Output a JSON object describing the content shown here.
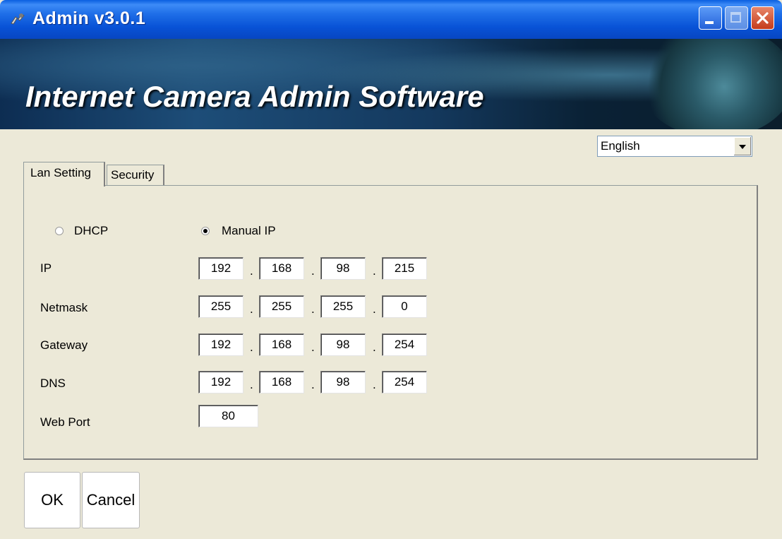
{
  "window": {
    "title": "Admin v3.0.1"
  },
  "banner": {
    "title": "Internet Camera Admin Software"
  },
  "language": {
    "selected": "English"
  },
  "tabs": [
    {
      "label": "Lan Setting",
      "active": true
    },
    {
      "label": "Security",
      "active": false
    }
  ],
  "lan": {
    "mode_options": [
      {
        "label": "DHCP",
        "checked": false
      },
      {
        "label": "Manual IP",
        "checked": true
      }
    ],
    "ip_label": "IP",
    "ip": [
      "192",
      "168",
      "98",
      "215"
    ],
    "netmask_label": "Netmask",
    "netmask": [
      "255",
      "255",
      "255",
      "0"
    ],
    "gateway_label": "Gateway",
    "gateway": [
      "192",
      "168",
      "98",
      "254"
    ],
    "dns_label": "DNS",
    "dns": [
      "192",
      "168",
      "98",
      "254"
    ],
    "webport_label": "Web Port",
    "webport": "80",
    "separator": "."
  },
  "buttons": {
    "ok": "OK",
    "cancel": "Cancel"
  },
  "colors": {
    "titlebar": "#0852D6",
    "window_bg": "#ECE9D8"
  }
}
